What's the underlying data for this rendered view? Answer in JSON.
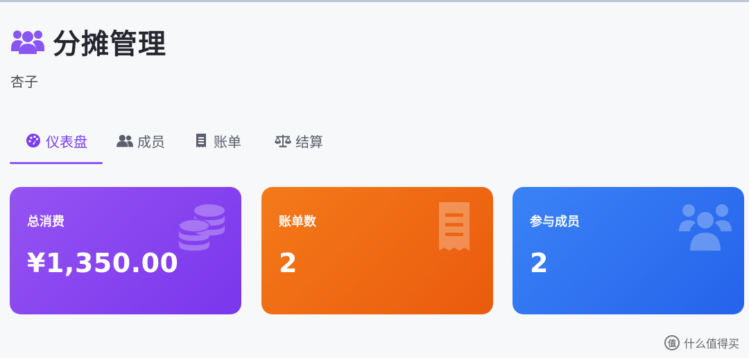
{
  "header": {
    "title": "分摊管理",
    "subtitle": "杏子",
    "icon": "users-icon"
  },
  "tabs": [
    {
      "label": "仪表盘",
      "icon": "dashboard-icon",
      "active": true
    },
    {
      "label": "成员",
      "icon": "users-icon",
      "active": false
    },
    {
      "label": "账单",
      "icon": "receipt-icon",
      "active": false
    },
    {
      "label": "结算",
      "icon": "balance-scale-icon",
      "active": false
    }
  ],
  "cards": [
    {
      "label": "总消费",
      "value": "¥1,350.00",
      "icon": "coins-icon",
      "color": "#8b47f0"
    },
    {
      "label": "账单数",
      "value": "2",
      "icon": "receipt-icon",
      "color": "#f06a14"
    },
    {
      "label": "参与成员",
      "value": "2",
      "icon": "users-icon",
      "color": "#2f74f1"
    }
  ],
  "watermark": {
    "text": "什么值得买",
    "logo": "值"
  },
  "colors": {
    "accent": "#8a55f5",
    "background": "#f7f8fa"
  }
}
